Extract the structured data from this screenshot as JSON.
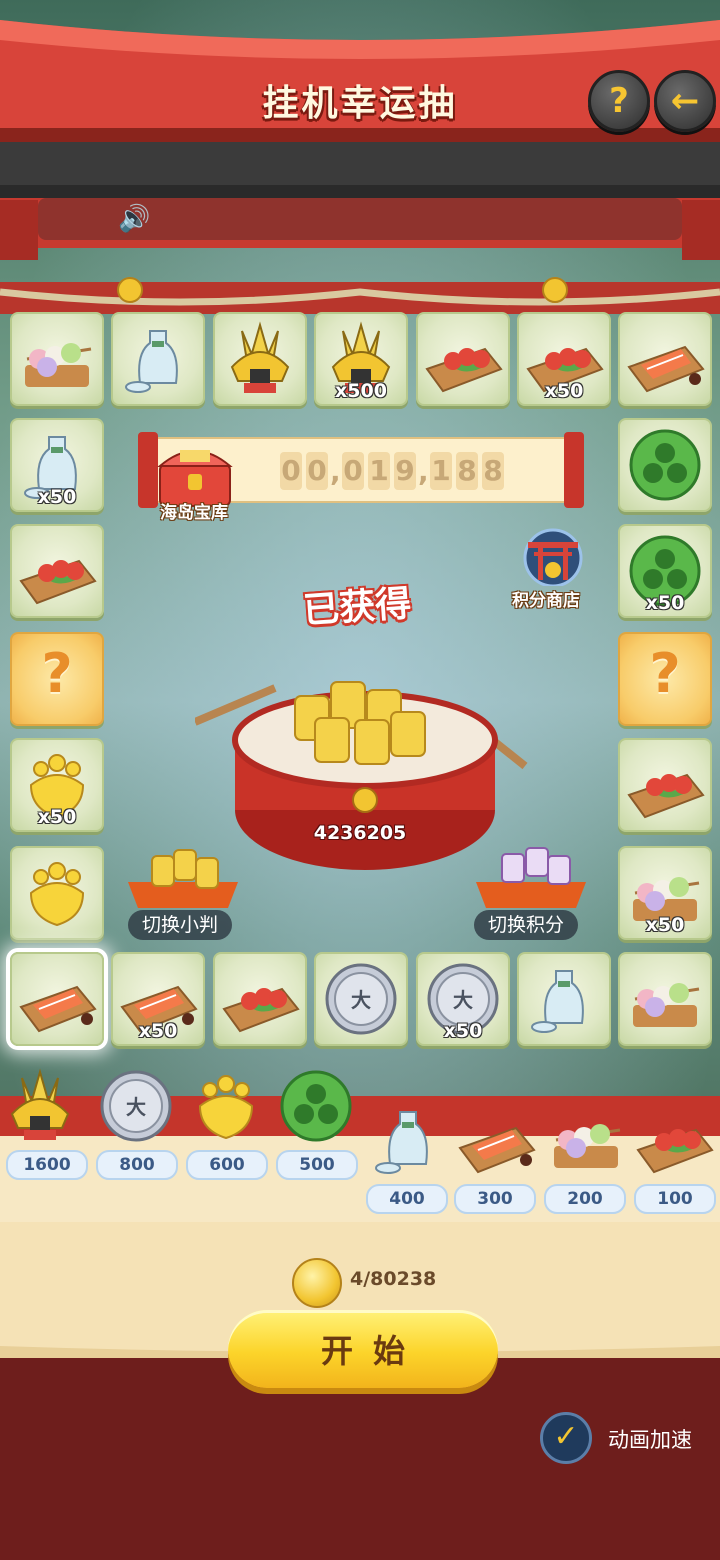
{
  "header": {
    "title": "挂机幸运抽",
    "help_icon": "?",
    "back_icon": "←"
  },
  "board": {
    "top_row": [
      {
        "icon": "dango",
        "count": ""
      },
      {
        "icon": "sake-bottle",
        "count": ""
      },
      {
        "icon": "samurai-helmet",
        "count": ""
      },
      {
        "icon": "samurai-helmet",
        "count": "x500"
      },
      {
        "icon": "tomato-plate",
        "count": ""
      },
      {
        "icon": "tomato-plate",
        "count": "x50"
      },
      {
        "icon": "salmon-sashimi",
        "count": ""
      }
    ],
    "left_col": [
      {
        "icon": "sake-bottle",
        "count": "x50"
      },
      {
        "icon": "tomato-plate",
        "count": ""
      },
      {
        "icon": "question",
        "count": ""
      },
      {
        "icon": "gold-paulownia",
        "count": "x50"
      },
      {
        "icon": "gold-paulownia",
        "count": ""
      }
    ],
    "right_col": [
      {
        "icon": "green-crest",
        "count": ""
      },
      {
        "icon": "green-crest",
        "count": "x50"
      },
      {
        "icon": "question",
        "count": ""
      },
      {
        "icon": "tomato-plate",
        "count": ""
      },
      {
        "icon": "dango",
        "count": "x50"
      }
    ],
    "bottom_row": [
      {
        "icon": "salmon-sashimi",
        "count": ""
      },
      {
        "icon": "salmon-sashimi",
        "count": "x50"
      },
      {
        "icon": "tomato-plate",
        "count": ""
      },
      {
        "icon": "silver-coin",
        "count": ""
      },
      {
        "icon": "silver-coin",
        "count": "x50"
      },
      {
        "icon": "sake-bottle",
        "count": ""
      },
      {
        "icon": "dango",
        "count": ""
      }
    ]
  },
  "treasury": {
    "label": "海岛宝库",
    "digits": [
      "0",
      "0",
      ",",
      "0",
      "1",
      "9",
      ",",
      "1",
      "8",
      "8"
    ]
  },
  "shop_label": "积分商店",
  "obtained_label": "已获得",
  "drum_value": "4236205",
  "switch_koban": "切换小判",
  "switch_points": "切换积分",
  "rewards": [
    {
      "icon": "samurai-helmet",
      "price": "1600"
    },
    {
      "icon": "silver-coin",
      "price": "800"
    },
    {
      "icon": "gold-paulownia",
      "price": "600"
    },
    {
      "icon": "green-crest",
      "price": "500"
    },
    {
      "icon": "sake-bottle",
      "price": "400"
    },
    {
      "icon": "salmon-sashimi",
      "price": "300"
    },
    {
      "icon": "dango",
      "price": "200"
    },
    {
      "icon": "tomato-plate",
      "price": "100"
    }
  ],
  "coins": "4/80238",
  "start_label": "开始",
  "anim_speed_label": "动画加速",
  "anim_speed_checked": true
}
